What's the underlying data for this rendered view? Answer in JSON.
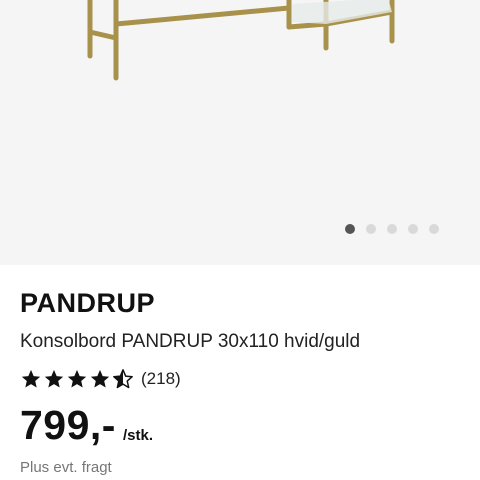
{
  "gallery": {
    "image_alt": "Konsolbord PANDRUP",
    "slide_count": 5,
    "active_slide": 1
  },
  "product": {
    "brand": "PANDRUP",
    "title": "Konsolbord PANDRUP 30x110 hvid/guld",
    "rating": 4.5,
    "rating_max": 5,
    "review_count": "(218)",
    "price": "799,-",
    "unit": "/stk.",
    "shipping_note": "Plus evt. fragt"
  }
}
